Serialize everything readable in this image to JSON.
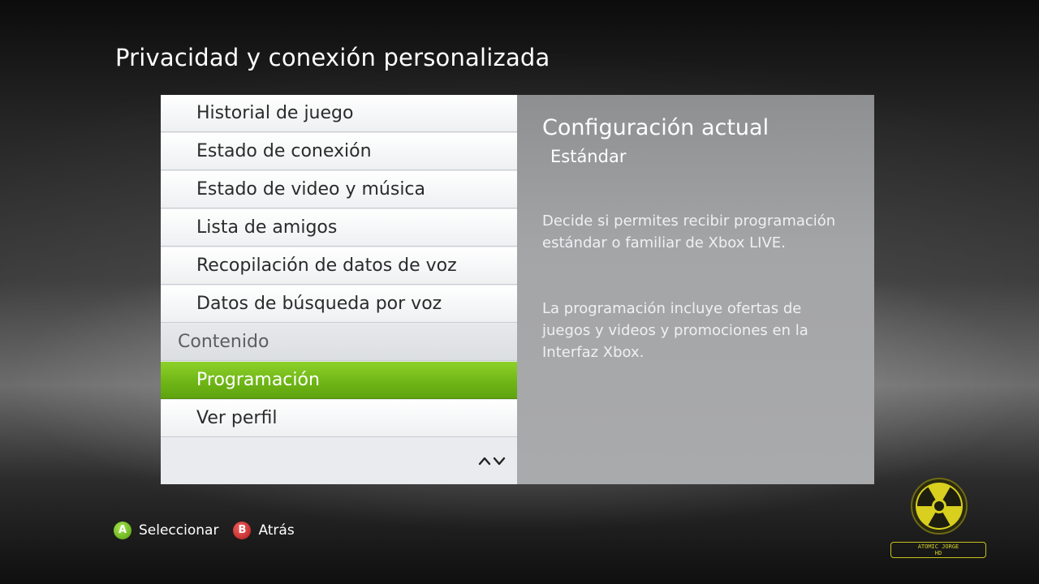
{
  "page": {
    "title": "Privacidad y conexión personalizada"
  },
  "menu": {
    "items": [
      {
        "label": "Historial de juego",
        "type": "item"
      },
      {
        "label": "Estado de conexión",
        "type": "item"
      },
      {
        "label": "Estado de video y música",
        "type": "item"
      },
      {
        "label": "Lista de amigos",
        "type": "item"
      },
      {
        "label": "Recopilación de datos de voz",
        "type": "item"
      },
      {
        "label": "Datos de búsqueda por voz",
        "type": "item"
      },
      {
        "label": "Contenido",
        "type": "header"
      },
      {
        "label": "Programación",
        "type": "item",
        "selected": true
      },
      {
        "label": "Ver perfil",
        "type": "item"
      }
    ],
    "scroll_arrows": "^v",
    "selection_color": "#6fb616"
  },
  "info": {
    "title": "Configuración actual",
    "value": "Estándar",
    "paragraphs": [
      "Decide si permites recibir programación estándar o familiar de Xbox LIVE.",
      "La programación incluye ofertas de juegos y videos y promociones en la Interfaz Xbox."
    ]
  },
  "footer": {
    "a_glyph": "A",
    "a_label": "Seleccionar",
    "b_glyph": "B",
    "b_label": "Atrás"
  },
  "watermark": {
    "line1": "ATOMIC JORGE",
    "line2": "HD",
    "icon": "radiation-icon"
  }
}
